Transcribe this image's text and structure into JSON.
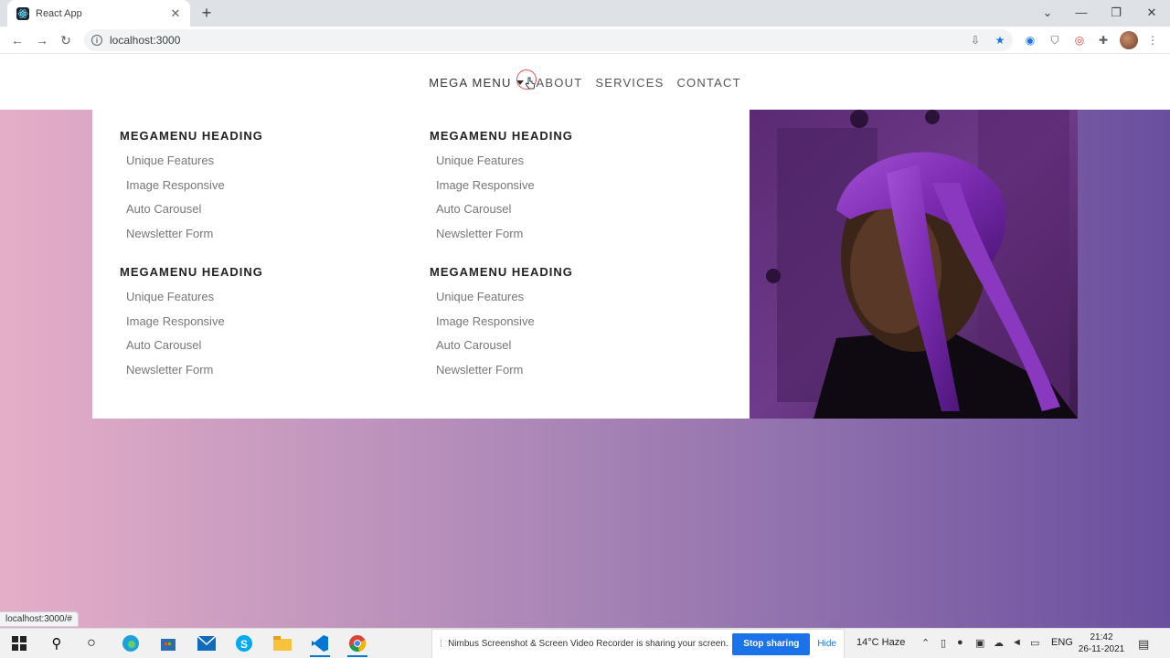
{
  "browser": {
    "tab_title": "React App",
    "tab_close": "✕",
    "new_tab": "+",
    "url": "localhost:3000",
    "status_url": "localhost:3000/#",
    "window_controls": {
      "chevron": "⌄",
      "minimize": "—",
      "restore": "❐",
      "close": "✕"
    }
  },
  "navbar": {
    "items": [
      {
        "label": "MEGA MENU",
        "has_caret": true
      },
      {
        "label": "ABOUT"
      },
      {
        "label": "SERVICES"
      },
      {
        "label": "CONTACT"
      }
    ]
  },
  "megamenu": {
    "columns": [
      {
        "heading": "MEGAMENU HEADING",
        "links": [
          "Unique Features",
          "Image Responsive",
          "Auto Carousel",
          "Newsletter Form"
        ]
      },
      {
        "heading": "MEGAMENU HEADING",
        "links": [
          "Unique Features",
          "Image Responsive",
          "Auto Carousel",
          "Newsletter Form"
        ]
      },
      {
        "heading": "MEGAMENU HEADING",
        "links": [
          "Unique Features",
          "Image Responsive",
          "Auto Carousel",
          "Newsletter Form"
        ]
      },
      {
        "heading": "MEGAMENU HEADING",
        "links": [
          "Unique Features",
          "Image Responsive",
          "Auto Carousel",
          "Newsletter Form"
        ]
      }
    ]
  },
  "colors": {
    "gradient_left": "#e5aec8",
    "gradient_mid": "#a784b6",
    "gradient_right": "#6a4f9f",
    "chrome_accent": "#1a73e8"
  },
  "taskbar": {
    "share_message": "Nimbus Screenshot & Screen Video Recorder is sharing your screen.",
    "share_stop": "Stop sharing",
    "share_hide": "Hide",
    "weather": "14°C  Haze",
    "language": "ENG",
    "time": "21:42",
    "date": "26-11-2021"
  }
}
